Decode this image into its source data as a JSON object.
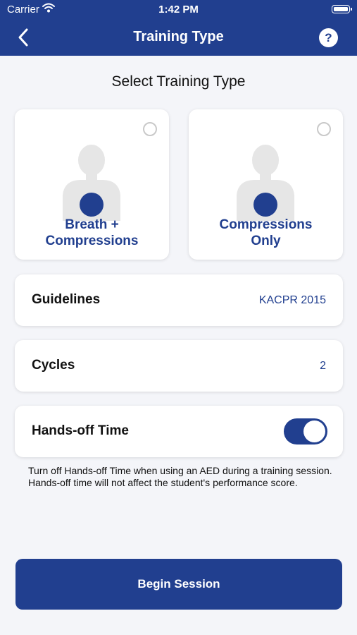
{
  "status_bar": {
    "carrier": "Carrier",
    "time": "1:42 PM"
  },
  "nav": {
    "title": "Training Type",
    "help_label": "?"
  },
  "section_title": "Select Training Type",
  "training_types": [
    {
      "line1": "Breath +",
      "line2": "Compressions",
      "selected": false
    },
    {
      "line1": "Compressions",
      "line2": "Only",
      "selected": false
    }
  ],
  "settings": {
    "guidelines": {
      "label": "Guidelines",
      "value": "KACPR 2015"
    },
    "cycles": {
      "label": "Cycles",
      "value": "2"
    },
    "hands_off": {
      "label": "Hands-off Time",
      "enabled": true
    }
  },
  "note": "Turn off Hands-off Time when using an AED during a training session. Hands-off time will not affect the student's performance score.",
  "begin_button": "Begin Session",
  "colors": {
    "primary": "#213f8f",
    "background": "#f4f5f9",
    "card": "#ffffff"
  }
}
